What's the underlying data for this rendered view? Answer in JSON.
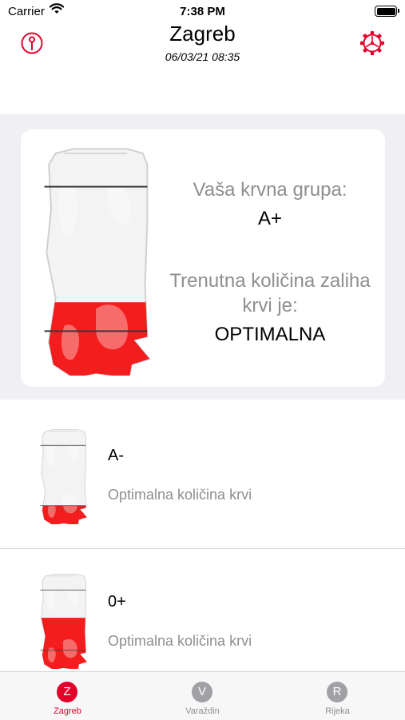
{
  "status_bar": {
    "carrier": "Carrier",
    "time": "7:38 PM"
  },
  "header": {
    "title": "Zagreb",
    "datetime": "06/03/21 08:35"
  },
  "card": {
    "group_label": "Vaša krvna grupa:",
    "group_value": "A+",
    "supply_label_line1": "Trenutna količina zaliha",
    "supply_label_line2": "krvi je:",
    "supply_value": "OPTIMALNA",
    "fill_level": 0.33
  },
  "list": [
    {
      "group": "A-",
      "status": "Optimalna količina krvi",
      "fill_level": 0.2
    },
    {
      "group": "0+",
      "status": "Optimalna količina krvi",
      "fill_level": 0.55
    }
  ],
  "tabs": [
    {
      "letter": "Z",
      "label": "Zagreb",
      "active": true
    },
    {
      "letter": "V",
      "label": "Varaždin",
      "active": false
    },
    {
      "letter": "R",
      "label": "Rijeka",
      "active": false
    }
  ],
  "colors": {
    "accent": "#e4002b",
    "blood": "#f41d1d",
    "inactive": "#8e8e93",
    "muted": "#a0a0a5"
  }
}
